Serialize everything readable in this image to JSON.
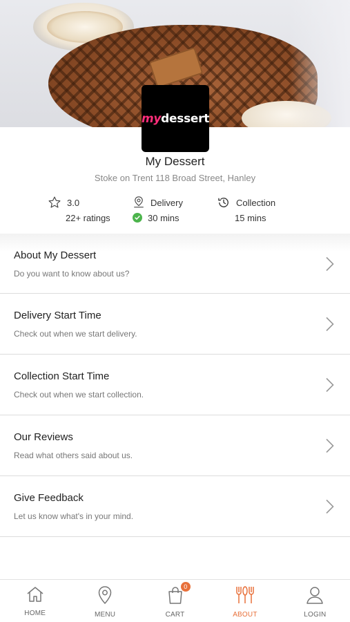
{
  "store": {
    "logo_my": "my",
    "logo_word": "dessert",
    "name": "My Dessert",
    "address": "Stoke on Trent 118 Broad Street, Hanley"
  },
  "stats": {
    "rating_value": "3.0",
    "rating_count": "22+ ratings",
    "delivery_label": "Delivery",
    "delivery_time": "30 mins",
    "collection_label": "Collection",
    "collection_time": "15 mins"
  },
  "menu": [
    {
      "title": "About My Dessert",
      "subtitle": "Do you want to know about us?"
    },
    {
      "title": "Delivery Start Time",
      "subtitle": "Check out when we start delivery."
    },
    {
      "title": "Collection Start Time",
      "subtitle": "Check out when we start collection."
    },
    {
      "title": "Our Reviews",
      "subtitle": "Read what others said about us."
    },
    {
      "title": "Give Feedback",
      "subtitle": "Let us know what's in your mind."
    }
  ],
  "tabs": [
    {
      "label": "HOME",
      "icon": "home-icon"
    },
    {
      "label": "MENU",
      "icon": "location-pin-icon"
    },
    {
      "label": "CART",
      "icon": "shopping-bag-icon",
      "badge": "0"
    },
    {
      "label": "ABOUT",
      "icon": "cutlery-icon",
      "active": true
    },
    {
      "label": "LOGIN",
      "icon": "user-icon"
    }
  ],
  "colors": {
    "accent": "#e8703a",
    "check_green": "#4cb44c",
    "logo_pink": "#ff2e7a"
  }
}
